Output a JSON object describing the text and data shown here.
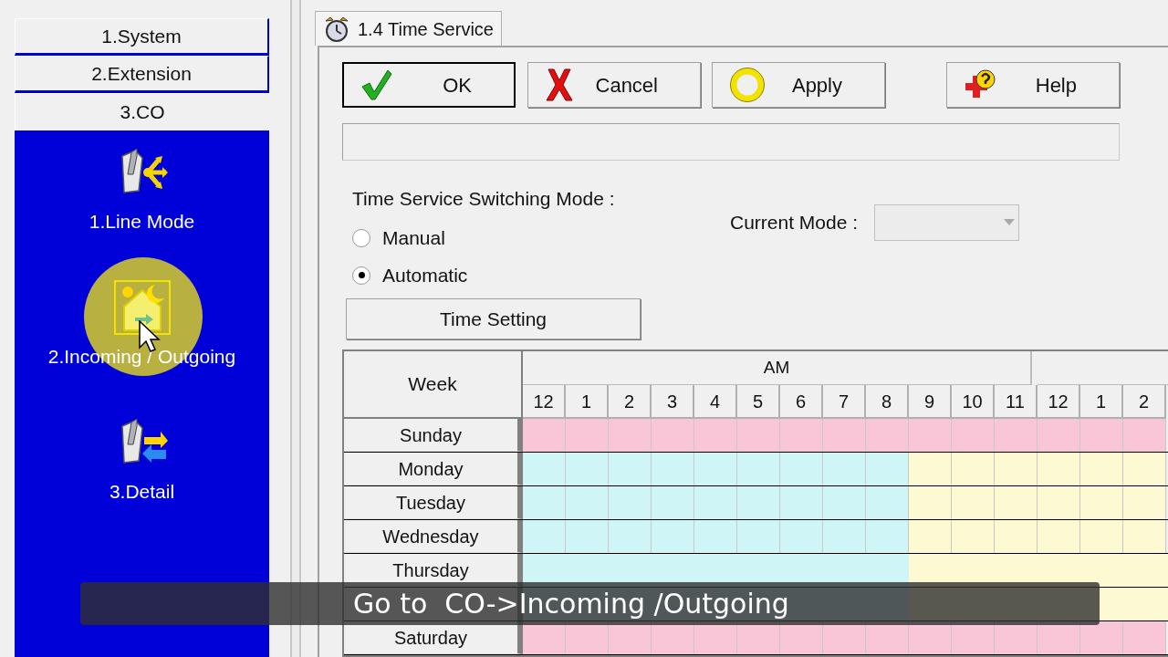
{
  "sidebar": {
    "sections": [
      {
        "label": "1.System",
        "expanded": false
      },
      {
        "label": "2.Extension",
        "expanded": false
      },
      {
        "label": "3.CO",
        "expanded": true,
        "items": [
          {
            "label": "1.Line Mode",
            "kind": "tools",
            "pointed": false
          },
          {
            "label": "2.Incoming / Outgoing",
            "kind": "house",
            "pointed": true
          },
          {
            "label": "3.Detail",
            "kind": "detail",
            "pointed": false
          }
        ]
      }
    ]
  },
  "tab": {
    "label": "1.4 Time Service",
    "selected": true
  },
  "buttons": [
    {
      "label": "OK",
      "kind": "ok",
      "default": true
    },
    {
      "label": "Cancel",
      "kind": "cancel",
      "default": false
    },
    {
      "label": "Apply",
      "kind": "apply",
      "default": false
    },
    {
      "label": "Help",
      "kind": "help",
      "default": false
    }
  ],
  "mode": {
    "label": "Time Service Switching Mode :",
    "options": [
      {
        "label": "Manual",
        "selected": false
      },
      {
        "label": "Automatic",
        "selected": true
      }
    ],
    "current_label": "Current Mode :",
    "current_disabled": true
  },
  "time_setting_button": "Time Setting",
  "schedule": {
    "week_header": "Week",
    "period_groups": [
      {
        "label": "AM"
      }
    ],
    "hours": [
      "12",
      "1",
      "2",
      "3",
      "4",
      "5",
      "6",
      "7",
      "8",
      "9",
      "10",
      "11",
      "12",
      "1",
      "2"
    ],
    "rows": [
      {
        "day": "Sunday",
        "cells": [
          {
            "color": "#f9c6d8"
          },
          {
            "color": "#f9c6d8"
          },
          {
            "color": "#f9c6d8"
          },
          {
            "color": "#f9c6d8"
          },
          {
            "color": "#f9c6d8"
          },
          {
            "color": "#f9c6d8"
          },
          {
            "color": "#f9c6d8"
          },
          {
            "color": "#f9c6d8"
          },
          {
            "color": "#f9c6d8"
          },
          {
            "color": "#f9c6d8"
          },
          {
            "color": "#f9c6d8"
          },
          {
            "color": "#f9c6d8"
          },
          {
            "color": "#f9c6d8"
          },
          {
            "color": "#f9c6d8"
          },
          {
            "color": "#f9c6d8"
          }
        ]
      },
      {
        "day": "Monday",
        "cells": [
          {
            "color": "#cff5f7"
          },
          {
            "color": "#cff5f7"
          },
          {
            "color": "#cff5f7"
          },
          {
            "color": "#cff5f7"
          },
          {
            "color": "#cff5f7"
          },
          {
            "color": "#cff5f7"
          },
          {
            "color": "#cff5f7"
          },
          {
            "color": "#cff5f7"
          },
          {
            "color": "#cff5f7"
          },
          {
            "color": "#fdfad3"
          },
          {
            "color": "#fdfad3"
          },
          {
            "color": "#fdfad3"
          },
          {
            "color": "#fdfad3"
          },
          {
            "color": "#fdfad3"
          },
          {
            "color": "#fdfad3"
          }
        ]
      },
      {
        "day": "Tuesday",
        "cells": [
          {
            "color": "#cff5f7"
          },
          {
            "color": "#cff5f7"
          },
          {
            "color": "#cff5f7"
          },
          {
            "color": "#cff5f7"
          },
          {
            "color": "#cff5f7"
          },
          {
            "color": "#cff5f7"
          },
          {
            "color": "#cff5f7"
          },
          {
            "color": "#cff5f7"
          },
          {
            "color": "#cff5f7"
          },
          {
            "color": "#fdfad3"
          },
          {
            "color": "#fdfad3"
          },
          {
            "color": "#fdfad3"
          },
          {
            "color": "#fdfad3"
          },
          {
            "color": "#fdfad3"
          },
          {
            "color": "#fdfad3"
          }
        ]
      },
      {
        "day": "Wednesday",
        "cells": [
          {
            "color": "#cff5f7"
          },
          {
            "color": "#cff5f7"
          },
          {
            "color": "#cff5f7"
          },
          {
            "color": "#cff5f7"
          },
          {
            "color": "#cff5f7"
          },
          {
            "color": "#cff5f7"
          },
          {
            "color": "#cff5f7"
          },
          {
            "color": "#cff5f7"
          },
          {
            "color": "#cff5f7"
          },
          {
            "color": "#fdfad3"
          },
          {
            "color": "#fdfad3"
          },
          {
            "color": "#fdfad3"
          },
          {
            "color": "#fdfad3"
          },
          {
            "color": "#fdfad3"
          },
          {
            "color": "#fdfad3"
          }
        ]
      },
      {
        "day": "Thursday"
      },
      {
        "covered": true
      },
      {
        "day": "Saturday",
        "cells": [
          {
            "color": "#f9c6d8"
          },
          {
            "color": "#f9c6d8"
          },
          {
            "color": "#f9c6d8"
          },
          {
            "color": "#f9c6d8"
          },
          {
            "color": "#f9c6d8"
          },
          {
            "color": "#f9c6d8"
          },
          {
            "color": "#f9c6d8"
          },
          {
            "color": "#f9c6d8"
          },
          {
            "color": "#f9c6d8"
          },
          {
            "color": "#f9c6d8"
          },
          {
            "color": "#f9c6d8"
          },
          {
            "color": "#f9c6d8"
          },
          {
            "color": "#f9c6d8"
          },
          {
            "color": "#f9c6d8"
          },
          {
            "color": "#f9c6d8"
          }
        ]
      }
    ]
  },
  "caption": "Go to  CO->Incoming /Outgoing"
}
